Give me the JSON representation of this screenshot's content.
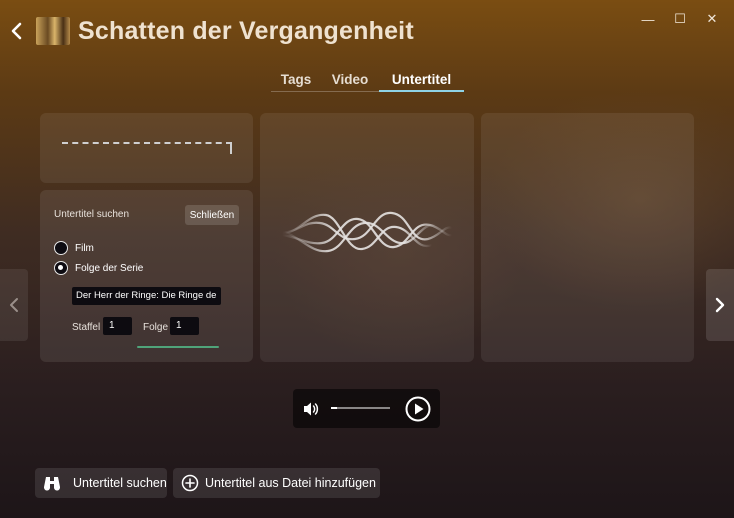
{
  "window": {
    "title": "Schatten der Vergangenheit",
    "minimize_glyph": "—",
    "maximize_glyph": "☐",
    "close_glyph": "✕"
  },
  "tabs": [
    {
      "label": "Tags",
      "active": false
    },
    {
      "label": "Video",
      "active": false
    },
    {
      "label": "Untertitel",
      "active": true
    }
  ],
  "search_panel": {
    "title": "Untertitel suchen",
    "close_label": "Schließen",
    "options": [
      {
        "label": "Film",
        "checked": false
      },
      {
        "label": "Folge der Serie",
        "checked": true
      }
    ],
    "series_value": "Der Herr der Ringe: Die Ringe de",
    "season_label": "Staffel",
    "season_value": "1",
    "episode_label": "Folge",
    "episode_value": "1"
  },
  "player": {
    "volume_fraction": 0.1,
    "icons": [
      "volume-icon",
      "play-icon"
    ]
  },
  "actions": {
    "search_label": "Untertitel suchen",
    "add_file_label": "Untertitel aus Datei hinzufügen"
  },
  "icons": {
    "back": "chevron-left-icon",
    "prev": "chevron-left-icon",
    "next": "chevron-right-icon",
    "search": "binoculars-icon",
    "add": "plus-circle-icon"
  },
  "colors": {
    "tab_accent": "#8fd3e6",
    "progress_green": "#4fa47a"
  }
}
